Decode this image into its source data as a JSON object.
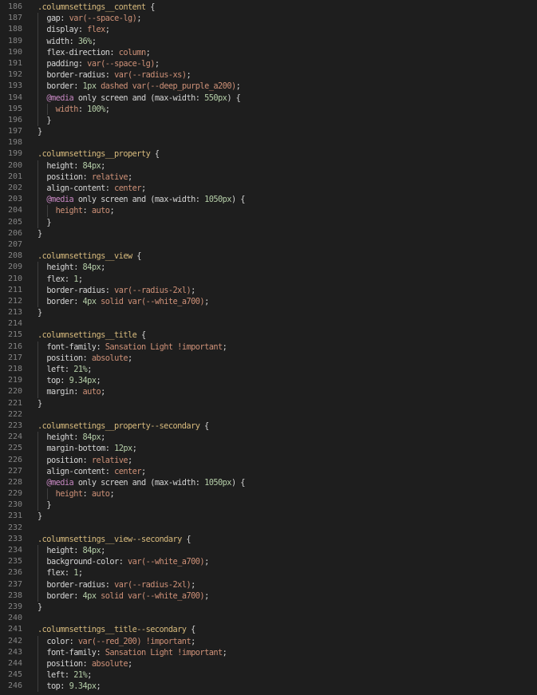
{
  "colors": {
    "background": "#1e1e1e",
    "line_number": "#858585",
    "selector": "#d7ba7d",
    "property": "#9cdcfe",
    "value_string": "#ce9178",
    "number": "#b5cea8",
    "at_rule": "#c586c0",
    "punctuation": "#d4d4d4"
  },
  "lines": [
    {
      "n": "186",
      "indent": 0,
      "tokens": [
        {
          "t": ".columnsettings__content",
          "c": "sel"
        },
        {
          "t": " {",
          "c": "punc"
        }
      ]
    },
    {
      "n": "187",
      "indent": 1,
      "tokens": [
        {
          "t": "gap",
          "c": "plain"
        },
        {
          "t": ": ",
          "c": "punc"
        },
        {
          "t": "var(--space-lg)",
          "c": "orange"
        },
        {
          "t": ";",
          "c": "punc"
        }
      ]
    },
    {
      "n": "188",
      "indent": 1,
      "tokens": [
        {
          "t": "display",
          "c": "plain"
        },
        {
          "t": ": ",
          "c": "punc"
        },
        {
          "t": "flex",
          "c": "orange"
        },
        {
          "t": ";",
          "c": "punc"
        }
      ]
    },
    {
      "n": "189",
      "indent": 1,
      "tokens": [
        {
          "t": "width",
          "c": "plain"
        },
        {
          "t": ": ",
          "c": "punc"
        },
        {
          "t": "36%",
          "c": "num"
        },
        {
          "t": ";",
          "c": "punc"
        }
      ]
    },
    {
      "n": "190",
      "indent": 1,
      "tokens": [
        {
          "t": "flex-direction",
          "c": "plain"
        },
        {
          "t": ": ",
          "c": "punc"
        },
        {
          "t": "column",
          "c": "orange"
        },
        {
          "t": ";",
          "c": "punc"
        }
      ]
    },
    {
      "n": "191",
      "indent": 1,
      "tokens": [
        {
          "t": "padding",
          "c": "plain"
        },
        {
          "t": ": ",
          "c": "punc"
        },
        {
          "t": "var(--space-lg)",
          "c": "orange"
        },
        {
          "t": ";",
          "c": "punc"
        }
      ]
    },
    {
      "n": "192",
      "indent": 1,
      "tokens": [
        {
          "t": "border-radius",
          "c": "plain"
        },
        {
          "t": ": ",
          "c": "punc"
        },
        {
          "t": "var(--radius-xs)",
          "c": "orange"
        },
        {
          "t": ";",
          "c": "punc"
        }
      ]
    },
    {
      "n": "193",
      "indent": 1,
      "tokens": [
        {
          "t": "border",
          "c": "plain"
        },
        {
          "t": ": ",
          "c": "punc"
        },
        {
          "t": "1px",
          "c": "num"
        },
        {
          "t": " dashed var(--deep_purple_a200)",
          "c": "orange"
        },
        {
          "t": ";",
          "c": "punc"
        }
      ]
    },
    {
      "n": "194",
      "indent": 1,
      "tokens": [
        {
          "t": "@media",
          "c": "at"
        },
        {
          "t": " only screen and (",
          "c": "plain"
        },
        {
          "t": "max-width",
          "c": "plain"
        },
        {
          "t": ": ",
          "c": "punc"
        },
        {
          "t": "550px",
          "c": "num"
        },
        {
          "t": ") {",
          "c": "punc"
        }
      ]
    },
    {
      "n": "195",
      "indent": 2,
      "tokens": [
        {
          "t": "width",
          "c": "orange"
        },
        {
          "t": ": ",
          "c": "punc"
        },
        {
          "t": "100%",
          "c": "num"
        },
        {
          "t": ";",
          "c": "punc"
        }
      ]
    },
    {
      "n": "196",
      "indent": 1,
      "tokens": [
        {
          "t": "}",
          "c": "punc"
        }
      ]
    },
    {
      "n": "197",
      "indent": 0,
      "tokens": [
        {
          "t": "}",
          "c": "punc"
        }
      ]
    },
    {
      "n": "198",
      "indent": 0,
      "tokens": []
    },
    {
      "n": "199",
      "indent": 0,
      "tokens": [
        {
          "t": ".columnsettings__property",
          "c": "sel"
        },
        {
          "t": " {",
          "c": "punc"
        }
      ]
    },
    {
      "n": "200",
      "indent": 1,
      "tokens": [
        {
          "t": "height",
          "c": "plain"
        },
        {
          "t": ": ",
          "c": "punc"
        },
        {
          "t": "84px",
          "c": "num"
        },
        {
          "t": ";",
          "c": "punc"
        }
      ]
    },
    {
      "n": "201",
      "indent": 1,
      "tokens": [
        {
          "t": "position",
          "c": "plain"
        },
        {
          "t": ": ",
          "c": "punc"
        },
        {
          "t": "relative",
          "c": "orange"
        },
        {
          "t": ";",
          "c": "punc"
        }
      ]
    },
    {
      "n": "202",
      "indent": 1,
      "tokens": [
        {
          "t": "align-content",
          "c": "plain"
        },
        {
          "t": ": ",
          "c": "punc"
        },
        {
          "t": "center",
          "c": "orange"
        },
        {
          "t": ";",
          "c": "punc"
        }
      ]
    },
    {
      "n": "203",
      "indent": 1,
      "tokens": [
        {
          "t": "@media",
          "c": "at"
        },
        {
          "t": " only screen and (",
          "c": "plain"
        },
        {
          "t": "max-width",
          "c": "plain"
        },
        {
          "t": ": ",
          "c": "punc"
        },
        {
          "t": "1050px",
          "c": "num"
        },
        {
          "t": ") {",
          "c": "punc"
        }
      ]
    },
    {
      "n": "204",
      "indent": 2,
      "tokens": [
        {
          "t": "height",
          "c": "orange"
        },
        {
          "t": ": ",
          "c": "punc"
        },
        {
          "t": "auto",
          "c": "orange"
        },
        {
          "t": ";",
          "c": "punc"
        }
      ]
    },
    {
      "n": "205",
      "indent": 1,
      "tokens": [
        {
          "t": "}",
          "c": "punc"
        }
      ]
    },
    {
      "n": "206",
      "indent": 0,
      "tokens": [
        {
          "t": "}",
          "c": "punc"
        }
      ]
    },
    {
      "n": "207",
      "indent": 0,
      "tokens": []
    },
    {
      "n": "208",
      "indent": 0,
      "tokens": [
        {
          "t": ".columnsettings__view",
          "c": "sel"
        },
        {
          "t": " {",
          "c": "punc"
        }
      ]
    },
    {
      "n": "209",
      "indent": 1,
      "tokens": [
        {
          "t": "height",
          "c": "plain"
        },
        {
          "t": ": ",
          "c": "punc"
        },
        {
          "t": "84px",
          "c": "num"
        },
        {
          "t": ";",
          "c": "punc"
        }
      ]
    },
    {
      "n": "210",
      "indent": 1,
      "tokens": [
        {
          "t": "flex",
          "c": "plain"
        },
        {
          "t": ": ",
          "c": "punc"
        },
        {
          "t": "1",
          "c": "num"
        },
        {
          "t": ";",
          "c": "punc"
        }
      ]
    },
    {
      "n": "211",
      "indent": 1,
      "tokens": [
        {
          "t": "border-radius",
          "c": "plain"
        },
        {
          "t": ": ",
          "c": "punc"
        },
        {
          "t": "var(--radius-2xl)",
          "c": "orange"
        },
        {
          "t": ";",
          "c": "punc"
        }
      ]
    },
    {
      "n": "212",
      "indent": 1,
      "tokens": [
        {
          "t": "border",
          "c": "plain"
        },
        {
          "t": ": ",
          "c": "punc"
        },
        {
          "t": "4px",
          "c": "num"
        },
        {
          "t": " solid var(--white_a700)",
          "c": "orange"
        },
        {
          "t": ";",
          "c": "punc"
        }
      ]
    },
    {
      "n": "213",
      "indent": 0,
      "tokens": [
        {
          "t": "}",
          "c": "punc"
        }
      ]
    },
    {
      "n": "214",
      "indent": 0,
      "tokens": []
    },
    {
      "n": "215",
      "indent": 0,
      "tokens": [
        {
          "t": ".columnsettings__title",
          "c": "sel"
        },
        {
          "t": " {",
          "c": "punc"
        }
      ]
    },
    {
      "n": "216",
      "indent": 1,
      "tokens": [
        {
          "t": "font-family",
          "c": "plain"
        },
        {
          "t": ": ",
          "c": "punc"
        },
        {
          "t": "Sansation Light !important",
          "c": "orange"
        },
        {
          "t": ";",
          "c": "punc"
        }
      ]
    },
    {
      "n": "217",
      "indent": 1,
      "tokens": [
        {
          "t": "position",
          "c": "plain"
        },
        {
          "t": ": ",
          "c": "punc"
        },
        {
          "t": "absolute",
          "c": "orange"
        },
        {
          "t": ";",
          "c": "punc"
        }
      ]
    },
    {
      "n": "218",
      "indent": 1,
      "tokens": [
        {
          "t": "left",
          "c": "plain"
        },
        {
          "t": ": ",
          "c": "punc"
        },
        {
          "t": "21%",
          "c": "num"
        },
        {
          "t": ";",
          "c": "punc"
        }
      ]
    },
    {
      "n": "219",
      "indent": 1,
      "tokens": [
        {
          "t": "top",
          "c": "plain"
        },
        {
          "t": ": ",
          "c": "punc"
        },
        {
          "t": "9.34px",
          "c": "num"
        },
        {
          "t": ";",
          "c": "punc"
        }
      ]
    },
    {
      "n": "220",
      "indent": 1,
      "tokens": [
        {
          "t": "margin",
          "c": "plain"
        },
        {
          "t": ": ",
          "c": "punc"
        },
        {
          "t": "auto",
          "c": "orange"
        },
        {
          "t": ";",
          "c": "punc"
        }
      ]
    },
    {
      "n": "221",
      "indent": 0,
      "tokens": [
        {
          "t": "}",
          "c": "punc"
        }
      ]
    },
    {
      "n": "222",
      "indent": 0,
      "tokens": []
    },
    {
      "n": "223",
      "indent": 0,
      "tokens": [
        {
          "t": ".columnsettings__property--secondary",
          "c": "sel"
        },
        {
          "t": " {",
          "c": "punc"
        }
      ]
    },
    {
      "n": "224",
      "indent": 1,
      "tokens": [
        {
          "t": "height",
          "c": "plain"
        },
        {
          "t": ": ",
          "c": "punc"
        },
        {
          "t": "84px",
          "c": "num"
        },
        {
          "t": ";",
          "c": "punc"
        }
      ]
    },
    {
      "n": "225",
      "indent": 1,
      "tokens": [
        {
          "t": "margin-bottom",
          "c": "plain"
        },
        {
          "t": ": ",
          "c": "punc"
        },
        {
          "t": "12px",
          "c": "num"
        },
        {
          "t": ";",
          "c": "punc"
        }
      ]
    },
    {
      "n": "226",
      "indent": 1,
      "tokens": [
        {
          "t": "position",
          "c": "plain"
        },
        {
          "t": ": ",
          "c": "punc"
        },
        {
          "t": "relative",
          "c": "orange"
        },
        {
          "t": ";",
          "c": "punc"
        }
      ]
    },
    {
      "n": "227",
      "indent": 1,
      "tokens": [
        {
          "t": "align-content",
          "c": "plain"
        },
        {
          "t": ": ",
          "c": "punc"
        },
        {
          "t": "center",
          "c": "orange"
        },
        {
          "t": ";",
          "c": "punc"
        }
      ]
    },
    {
      "n": "228",
      "indent": 1,
      "tokens": [
        {
          "t": "@media",
          "c": "at"
        },
        {
          "t": " only screen and (",
          "c": "plain"
        },
        {
          "t": "max-width",
          "c": "plain"
        },
        {
          "t": ": ",
          "c": "punc"
        },
        {
          "t": "1050px",
          "c": "num"
        },
        {
          "t": ") {",
          "c": "punc"
        }
      ]
    },
    {
      "n": "229",
      "indent": 2,
      "tokens": [
        {
          "t": "height",
          "c": "orange"
        },
        {
          "t": ": ",
          "c": "punc"
        },
        {
          "t": "auto",
          "c": "orange"
        },
        {
          "t": ";",
          "c": "punc"
        }
      ]
    },
    {
      "n": "230",
      "indent": 1,
      "tokens": [
        {
          "t": "}",
          "c": "punc"
        }
      ]
    },
    {
      "n": "231",
      "indent": 0,
      "tokens": [
        {
          "t": "}",
          "c": "punc"
        }
      ]
    },
    {
      "n": "232",
      "indent": 0,
      "tokens": []
    },
    {
      "n": "233",
      "indent": 0,
      "tokens": [
        {
          "t": ".columnsettings__view--secondary",
          "c": "sel"
        },
        {
          "t": " {",
          "c": "punc"
        }
      ]
    },
    {
      "n": "234",
      "indent": 1,
      "tokens": [
        {
          "t": "height",
          "c": "plain"
        },
        {
          "t": ": ",
          "c": "punc"
        },
        {
          "t": "84px",
          "c": "num"
        },
        {
          "t": ";",
          "c": "punc"
        }
      ]
    },
    {
      "n": "235",
      "indent": 1,
      "tokens": [
        {
          "t": "background-color",
          "c": "plain"
        },
        {
          "t": ": ",
          "c": "punc"
        },
        {
          "t": "var(--white_a700)",
          "c": "orange"
        },
        {
          "t": ";",
          "c": "punc"
        }
      ]
    },
    {
      "n": "236",
      "indent": 1,
      "tokens": [
        {
          "t": "flex",
          "c": "plain"
        },
        {
          "t": ": ",
          "c": "punc"
        },
        {
          "t": "1",
          "c": "num"
        },
        {
          "t": ";",
          "c": "punc"
        }
      ]
    },
    {
      "n": "237",
      "indent": 1,
      "tokens": [
        {
          "t": "border-radius",
          "c": "plain"
        },
        {
          "t": ": ",
          "c": "punc"
        },
        {
          "t": "var(--radius-2xl)",
          "c": "orange"
        },
        {
          "t": ";",
          "c": "punc"
        }
      ]
    },
    {
      "n": "238",
      "indent": 1,
      "tokens": [
        {
          "t": "border",
          "c": "plain"
        },
        {
          "t": ": ",
          "c": "punc"
        },
        {
          "t": "4px",
          "c": "num"
        },
        {
          "t": " solid var(--white_a700)",
          "c": "orange"
        },
        {
          "t": ";",
          "c": "punc"
        }
      ]
    },
    {
      "n": "239",
      "indent": 0,
      "tokens": [
        {
          "t": "}",
          "c": "punc"
        }
      ]
    },
    {
      "n": "240",
      "indent": 0,
      "tokens": []
    },
    {
      "n": "241",
      "indent": 0,
      "tokens": [
        {
          "t": ".columnsettings__title--secondary",
          "c": "sel"
        },
        {
          "t": " {",
          "c": "punc"
        }
      ]
    },
    {
      "n": "242",
      "indent": 1,
      "tokens": [
        {
          "t": "color",
          "c": "plain"
        },
        {
          "t": ": ",
          "c": "punc"
        },
        {
          "t": "var(--red_200) !important",
          "c": "orange"
        },
        {
          "t": ";",
          "c": "punc"
        }
      ]
    },
    {
      "n": "243",
      "indent": 1,
      "tokens": [
        {
          "t": "font-family",
          "c": "plain"
        },
        {
          "t": ": ",
          "c": "punc"
        },
        {
          "t": "Sansation Light !important",
          "c": "orange"
        },
        {
          "t": ";",
          "c": "punc"
        }
      ]
    },
    {
      "n": "244",
      "indent": 1,
      "tokens": [
        {
          "t": "position",
          "c": "plain"
        },
        {
          "t": ": ",
          "c": "punc"
        },
        {
          "t": "absolute",
          "c": "orange"
        },
        {
          "t": ";",
          "c": "punc"
        }
      ]
    },
    {
      "n": "245",
      "indent": 1,
      "tokens": [
        {
          "t": "left",
          "c": "plain"
        },
        {
          "t": ": ",
          "c": "punc"
        },
        {
          "t": "21%",
          "c": "num"
        },
        {
          "t": ";",
          "c": "punc"
        }
      ]
    },
    {
      "n": "246",
      "indent": 1,
      "tokens": [
        {
          "t": "top",
          "c": "plain"
        },
        {
          "t": ": ",
          "c": "punc"
        },
        {
          "t": "9.34px",
          "c": "num"
        },
        {
          "t": ";",
          "c": "punc"
        }
      ]
    }
  ]
}
